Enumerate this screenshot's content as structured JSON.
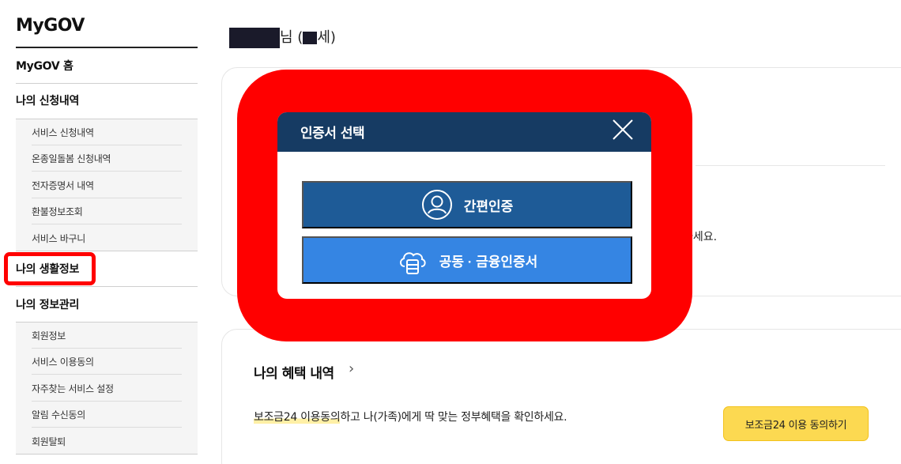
{
  "sidebar": {
    "title": "MyGOV",
    "home": "MyGOV 홈",
    "applications": {
      "label": "나의 신청내역",
      "items": [
        "서비스 신청내역",
        "온종일돌봄 신청내역",
        "전자증명서 내역",
        "환불정보조회",
        "서비스 바구니"
      ]
    },
    "life_info": {
      "label": "나의 생활정보"
    },
    "info_mgmt": {
      "label": "나의 정보관리",
      "items": [
        "회원정보",
        "서비스 이용동의",
        "자주찾는 서비스 설정",
        "알림 수신동의",
        "회원탈퇴"
      ]
    }
  },
  "header": {
    "user_suffix": "님 (",
    "age_suffix": "세)"
  },
  "card1": {
    "text_fragment": "하세요."
  },
  "benefits": {
    "title": "나의 혜택 내역",
    "chevron": "›",
    "highlight": "보조금24 이용동의",
    "text_rest": "하고 나(가족)에게 딱 맞는 정부혜택을 확인하세요.",
    "button": "보조금24 이용 동의하기"
  },
  "modal": {
    "title": "인증서 선택",
    "btn_easy": "간편인증",
    "btn_cert": "공동 · 금융인증서"
  },
  "colors": {
    "modal_header": "#163b63",
    "btn_easy": "#1e5b97",
    "btn_cert": "#3585e3",
    "highlight_red": "#ff0000",
    "consent_yellow": "#fcd951"
  },
  "icons": {
    "close": "close-icon",
    "easy_auth": "user-circle-icon",
    "cert": "cloud-server-icon",
    "chevron": "chevron-right-icon"
  }
}
